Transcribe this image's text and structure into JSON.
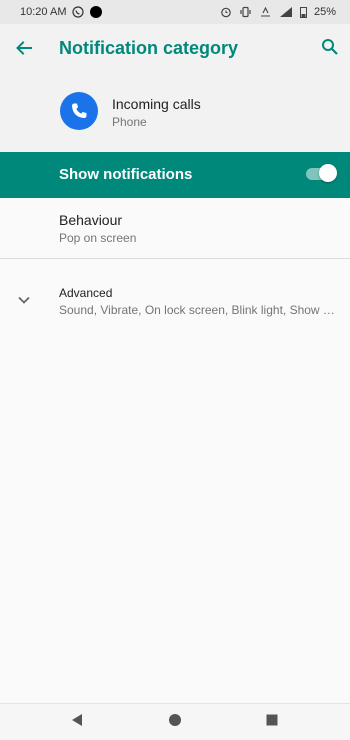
{
  "status_bar": {
    "time": "10:20 AM",
    "battery": "25%",
    "icons": [
      "whatsapp-icon",
      "notification-dot-icon",
      "alarm-icon",
      "vibrate-icon",
      "data-icon",
      "signal-icon",
      "battery-icon"
    ]
  },
  "toolbar": {
    "title": "Notification category",
    "back_icon": "arrow-left-icon",
    "search_icon": "search-icon"
  },
  "app_header": {
    "name": "Incoming calls",
    "subtitle": "Phone",
    "icon": "phone-icon"
  },
  "master_switch": {
    "label": "Show notifications",
    "enabled": true
  },
  "preferences": {
    "behaviour": {
      "title": "Behaviour",
      "summary": "Pop on screen"
    },
    "advanced": {
      "title": "Advanced",
      "summary": "Sound, Vibrate, On lock screen, Blink light, Show notification dot"
    }
  },
  "colors": {
    "accent": "#00897b",
    "app_icon_bg": "#1a73e8",
    "background": "#f2f2f2"
  },
  "nav_bar": {
    "icons": [
      "back-triangle-icon",
      "home-circle-icon",
      "recents-square-icon"
    ]
  }
}
